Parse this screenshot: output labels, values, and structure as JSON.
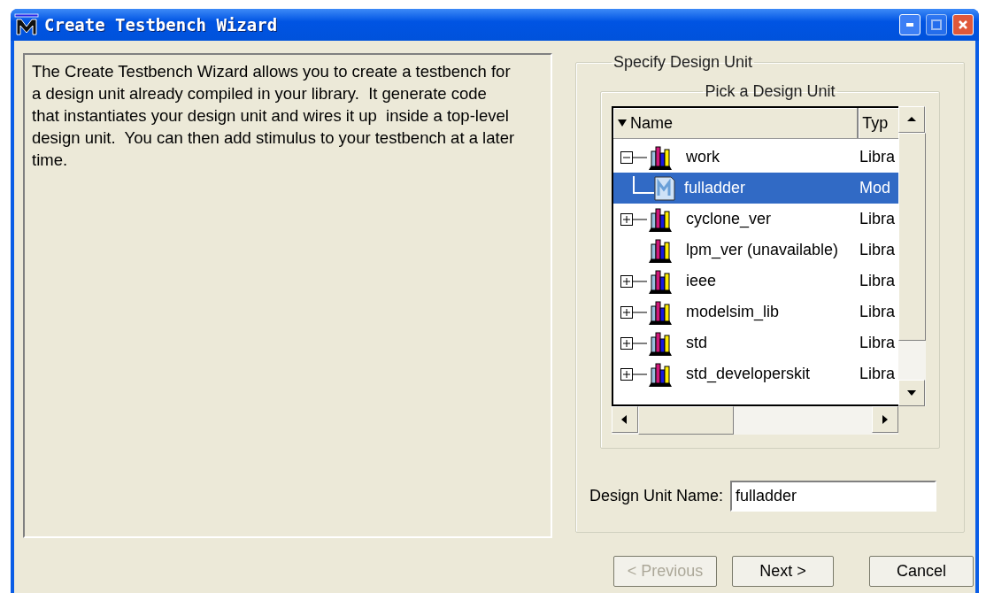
{
  "window": {
    "title": "Create Testbench Wizard"
  },
  "description": "The Create Testbench Wizard allows you to create a testbench for a design unit already compiled in your library.  It generate code that instantiates your design unit and wires it up  inside a top-level design unit.  You can then add stimulus to your testbench at a later time.",
  "specify_group": {
    "title": "Specify Design Unit",
    "pick_group": {
      "title": "Pick a Design Unit",
      "columns": [
        "Name",
        "Typ"
      ],
      "tree": [
        {
          "name": "work",
          "type": "Libra",
          "kind": "library",
          "expanded": true,
          "selected": false,
          "children": [
            {
              "name": "fulladder",
              "type": "Mod",
              "kind": "module",
              "selected": true
            }
          ]
        },
        {
          "name": "cyclone_ver",
          "type": "Libra",
          "kind": "library",
          "expanded": false,
          "selected": false
        },
        {
          "name": "lpm_ver  (unavailable)",
          "type": "Libra",
          "kind": "library",
          "selected": false
        },
        {
          "name": "ieee",
          "type": "Libra",
          "kind": "library",
          "expanded": false,
          "selected": false
        },
        {
          "name": "modelsim_lib",
          "type": "Libra",
          "kind": "library",
          "expanded": false,
          "selected": false
        },
        {
          "name": "std",
          "type": "Libra",
          "kind": "library",
          "expanded": false,
          "selected": false
        },
        {
          "name": "std_developerskit",
          "type": "Libra",
          "kind": "library",
          "expanded": false,
          "selected": false
        }
      ]
    },
    "name_field": {
      "label": "Design Unit Name:",
      "value": "fulladder"
    }
  },
  "buttons": [
    {
      "label": "< Previous",
      "disabled": true
    },
    {
      "label": "Next >",
      "disabled": false
    },
    {
      "label": "Cancel",
      "disabled": false
    }
  ]
}
